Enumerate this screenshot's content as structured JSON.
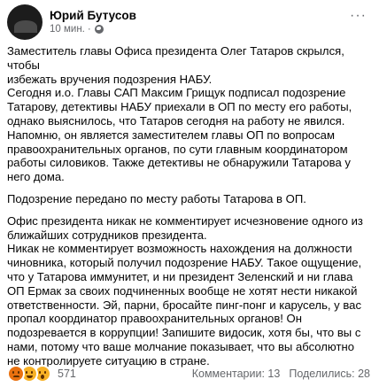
{
  "post": {
    "author": "Юрий Бутусов",
    "time": "10 мин.",
    "time_separator": "·",
    "more_label": "···",
    "paragraphs": [
      [
        "Заместитель главы Офиса президента Олег Татаров скрылся, чтобы",
        "избежать вручения подозрения НАБУ.",
        "Сегодня и.о. Главы САП Максим Грищук подписал подозрение",
        "Татарову, детективы НАБУ приехали в ОП по месту его работы,",
        "однако выяснилось, что Татаров сегодня на работу не явился.",
        "Напомню, он является заместителем главы ОП по вопросам",
        "правоохранительных органов, по сути главным координатором",
        "работы силовиков. Также детективы не обнаружили Татарова у",
        "него дома."
      ],
      [
        "Подозрение передано по месту работы Татарова в ОП."
      ],
      [
        "Офис президента никак не комментирует исчезновение одного из",
        "ближайших сотрудников президента.",
        "Никак не комментирует возможность нахождения на должности",
        "чиновника, который получил подозрение НАБУ. Такое ощущение,",
        "что у Татарова иммунитет, и ни президент Зеленский и ни глава",
        "ОП Ермак за своих подчиненных вообще не хотят нести никакой",
        "ответственности. Эй, парни, бросайте пинг-понг и карусель, у вас",
        "пропал координатор правоохранительных органов! Он",
        "подозревается в коррупции! Запишите видосик, хотя бы, что вы с",
        "нами, потому что ваше молчание показывает, что вы абсолютно",
        "не контролируете ситуацию в стране."
      ]
    ]
  },
  "footer": {
    "reactions": [
      "angry",
      "haha",
      "wow"
    ],
    "reaction_count": "571",
    "comments": "Комментарии: 13",
    "shares": "Поделились: 28"
  }
}
